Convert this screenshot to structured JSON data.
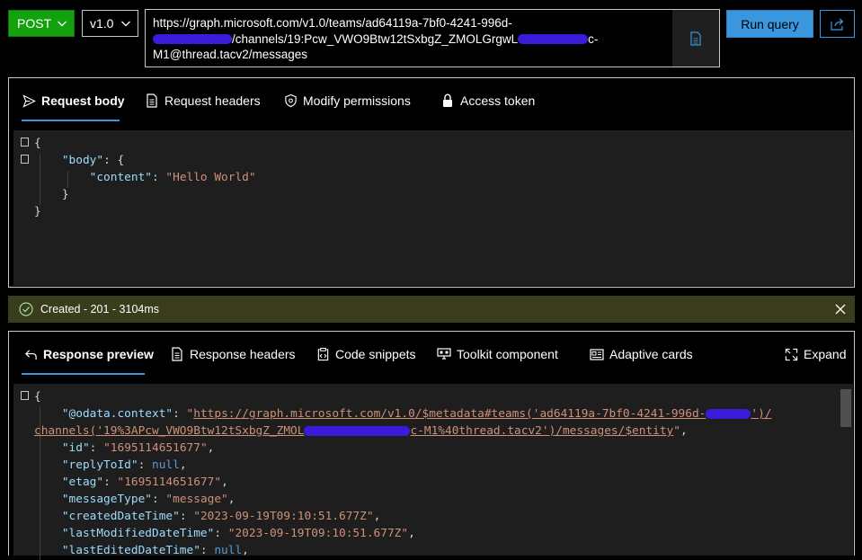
{
  "query": {
    "method": "POST",
    "version": "v1.0",
    "url_line1": "https://graph.microsoft.com/v1.0/teams/ad64119a-7bf0-4241-996d-",
    "url_line2_visible": "/channels/19:Pcw_VWO9Btw12tSxbgZ_ZMOLGrgwL",
    "url_line2_tail": "c-",
    "url_line3": "M1@thread.tacv2/messages",
    "run_label": "Run query"
  },
  "request_tabs": [
    {
      "label": "Request body",
      "icon": "send-icon"
    },
    {
      "label": "Request headers",
      "icon": "document-icon"
    },
    {
      "label": "Modify permissions",
      "icon": "shield-icon"
    },
    {
      "label": "Access token",
      "icon": "lock-icon"
    }
  ],
  "request_body": {
    "l1": "{",
    "l2_key": "\"body\"",
    "l2_rest": ": {",
    "l3_key": "\"content\"",
    "l3_sep": ": ",
    "l3_val": "\"Hello World\"",
    "l4": "}",
    "l5": "}"
  },
  "status": {
    "text": "Created - 201 - 3104ms",
    "color": "#393d1b"
  },
  "response_tabs": [
    {
      "label": "Response preview",
      "icon": "arrow-back-icon"
    },
    {
      "label": "Response headers",
      "icon": "document-icon"
    },
    {
      "label": "Code snippets",
      "icon": "clipboard-code-icon"
    },
    {
      "label": "Toolkit component",
      "icon": "component-icon"
    },
    {
      "label": "Adaptive cards",
      "icon": "card-icon"
    },
    {
      "label": "Expand",
      "icon": "expand-icon"
    }
  ],
  "response_body": {
    "open": "{",
    "context_key": "\"@odata.context\"",
    "context_val_a": "https://graph.microsoft.com/v1.0/$metadata#teams('ad64119a-7bf0-4241-996d-",
    "context_val_b": "')/",
    "context_val_c": "channels('19%3APcw_VWO9Btw12tSxbgZ_ZMOL",
    "context_val_d": "c-M1%40thread.tacv2')/messages/$entity",
    "id_key": "\"id\"",
    "id_val": "\"1695114651677\"",
    "reply_key": "\"replyToId\"",
    "reply_val": "null",
    "etag_key": "\"etag\"",
    "etag_val": "\"1695114651677\"",
    "mtype_key": "\"messageType\"",
    "mtype_val": "\"message\"",
    "created_key": "\"createdDateTime\"",
    "created_val": "\"2023-09-19T09:10:51.677Z\"",
    "lastmod_key": "\"lastModifiedDateTime\"",
    "lastmod_val": "\"2023-09-19T09:10:51.677Z\"",
    "lastedit_key": "\"lastEditedDateTime\"",
    "lastedit_val": "null"
  },
  "colors": {
    "accent": "#3a96dd",
    "method_green": "#13a10e",
    "json_key": "#9cdcfe",
    "json_string": "#ce9178",
    "json_keyword": "#569cd6"
  }
}
